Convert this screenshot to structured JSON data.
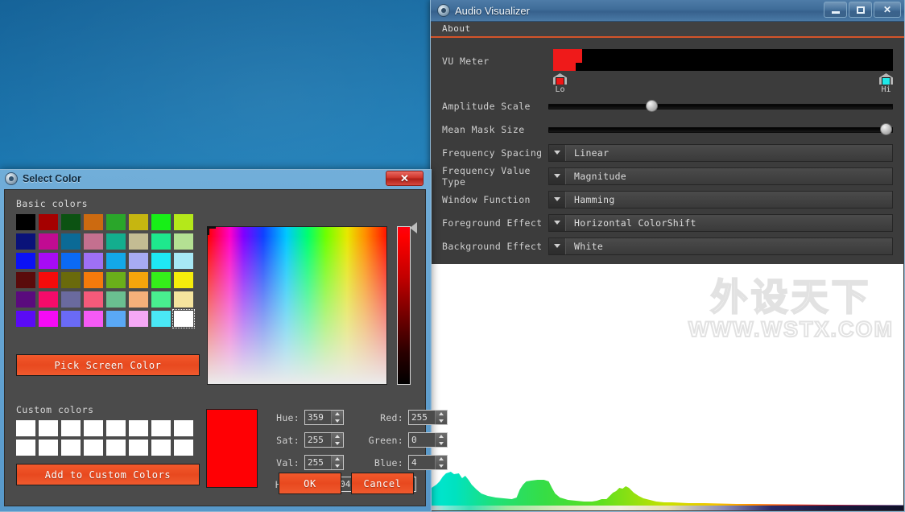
{
  "desktop": {
    "name": "windows-desktop-wallpaper"
  },
  "audio_visualizer": {
    "title": "Audio Visualizer",
    "window_buttons": {
      "minimize": "–",
      "maximize": "□",
      "close": "✕"
    },
    "menu": [
      {
        "label": "About"
      }
    ],
    "vu_meter": {
      "label": "VU Meter",
      "lo_label": "Lo",
      "hi_label": "Hi",
      "lo_color": "#f01515",
      "hi_color": "#1ee8e8",
      "level_color": "#ef1a1a"
    },
    "sliders": [
      {
        "label": "Amplitude Scale",
        "value_pct": 30
      },
      {
        "label": "Mean Mask Size",
        "value_pct": 98
      }
    ],
    "combos": [
      {
        "label": "Frequency Spacing",
        "value": "Linear"
      },
      {
        "label": "Frequency Value Type",
        "value": "Magnitude"
      },
      {
        "label": "Window Function",
        "value": "Hamming"
      },
      {
        "label": "Foreground Effect",
        "value": "Horizontal ColorShift"
      },
      {
        "label": "Background Effect",
        "value": "White"
      }
    ],
    "watermark": {
      "cn": "外设天下",
      "en": "WWW.WSTX.COM"
    }
  },
  "select_color": {
    "title": "Select Color",
    "close_label": "✕",
    "basic_colors_label": "Basic colors",
    "basic_colors": [
      "#000000",
      "#a50000",
      "#0c5212",
      "#cc6a10",
      "#2aa62a",
      "#c6b610",
      "#17ef17",
      "#b4e81a",
      "#0a1279",
      "#c10b92",
      "#0b6a96",
      "#c4708f",
      "#13ae8e",
      "#c3bc93",
      "#1ee88d",
      "#b4e093",
      "#0b12f5",
      "#a70bf5",
      "#0b6af5",
      "#9e70f5",
      "#13a8e8",
      "#a7abf3",
      "#1ee8f5",
      "#a7e8f5",
      "#5a0b0b",
      "#f50b0b",
      "#6a6a0b",
      "#f57a0b",
      "#6aaf1a",
      "#f5a50b",
      "#35ef1a",
      "#f5ec0b",
      "#5a0b7d",
      "#f50b6a",
      "#6a6a9e",
      "#f55a7a",
      "#6abf90",
      "#f5b07a",
      "#49ef8f",
      "#f5e49e",
      "#5a0bf5",
      "#f50bf5",
      "#6a6af5",
      "#f55af5",
      "#5aa8f5",
      "#f5a8f5",
      "#4ae8f5",
      "#ffffff"
    ],
    "selected_swatch_index": 47,
    "pick_screen_color_label": "Pick Screen Color",
    "custom_colors_label": "Custom colors",
    "custom_colors_count": 16,
    "add_to_custom_label": "Add to Custom Colors",
    "preview_color": "#ff0004",
    "fields": {
      "hue": {
        "label": "Hue:",
        "value": "359"
      },
      "sat": {
        "label": "Sat:",
        "value": "255"
      },
      "val": {
        "label": "Val:",
        "value": "255"
      },
      "red": {
        "label": "Red:",
        "value": "255"
      },
      "green": {
        "label": "Green:",
        "value": "0"
      },
      "blue": {
        "label": "Blue:",
        "value": "4"
      },
      "html": {
        "label": "HTML:",
        "value": "#ff0004"
      }
    },
    "ok_label": "OK",
    "cancel_label": "Cancel"
  }
}
